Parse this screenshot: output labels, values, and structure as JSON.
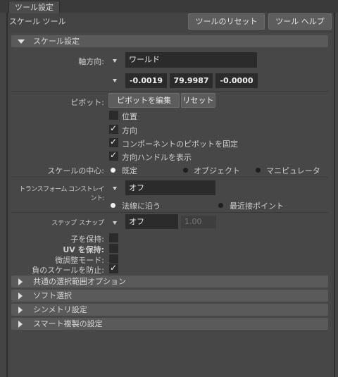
{
  "tab": {
    "label": "ツール設定"
  },
  "header": {
    "title": "スケール ツール",
    "reset_tool": "ツールのリセット",
    "tool_help": "ツール ヘルプ"
  },
  "scale_settings": {
    "section_title": "スケール設定",
    "axis_orientation": {
      "label": "軸方向:",
      "value": "ワールド"
    },
    "coords": {
      "x": "-0.0019",
      "y": "79.9987",
      "z": "-0.0000"
    },
    "pivot": {
      "label": "ピボット:",
      "edit": "ピボットを編集",
      "reset": "リセット"
    },
    "checkboxes": [
      {
        "label": "位置",
        "checked": false
      },
      {
        "label": "方向",
        "checked": true
      },
      {
        "label": "コンポーネントのピボットを固定",
        "checked": true
      },
      {
        "label": "方向ハンドルを表示",
        "checked": true
      }
    ],
    "scale_center": {
      "label": "スケールの中心:",
      "options": [
        "既定",
        "オブジェクト",
        "マニピュレータ"
      ],
      "selected": "既定"
    },
    "transform_constraint": {
      "label": "トランスフォーム コンストレイント:",
      "value": "オフ"
    },
    "constraint_options": {
      "options": [
        "法線に沿う",
        "最近接ポイント"
      ],
      "selected": "法線に沿う"
    },
    "step_snap": {
      "label": "ステップ スナップ",
      "value": "オフ",
      "amount": "1.00"
    },
    "flags": [
      {
        "label": "子を保持:",
        "checked": false
      },
      {
        "label": "UV を保持:",
        "checked": false
      },
      {
        "label": "微調整モード:",
        "checked": false
      },
      {
        "label": "負のスケールを防止:",
        "checked": true
      }
    ]
  },
  "collapsed_sections": [
    "共通の選択範囲オプション",
    "ソフト選択",
    "シンメトリ設定",
    "スマート複製の設定"
  ],
  "colors": {
    "background": "#444444",
    "section": "#5a5a5a",
    "field": "#2b2b2b"
  }
}
